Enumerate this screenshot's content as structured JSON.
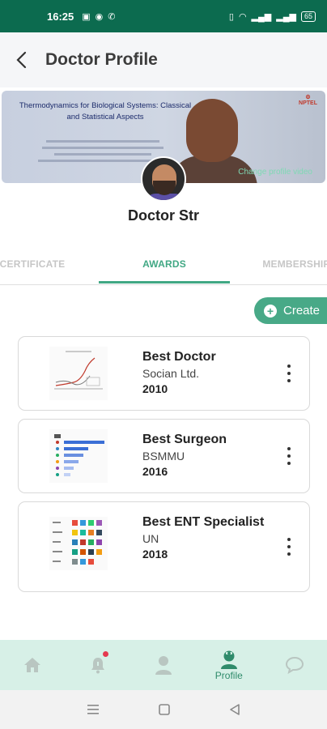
{
  "status_bar": {
    "time": "16:25",
    "battery": "65"
  },
  "header": {
    "title": "Doctor Profile"
  },
  "cover": {
    "slide_title": "Thermodynamics for Biological Systems: Classical and Statistical Aspects",
    "logo_text": "NPTEL",
    "video_link": "Change profile video"
  },
  "profile": {
    "name": "Doctor Str"
  },
  "tabs": [
    {
      "label": "CERTIFICATE",
      "active": false
    },
    {
      "label": "AWARDS",
      "active": true
    },
    {
      "label": "MEMBERSHIP",
      "active": false
    }
  ],
  "actions": {
    "create_label": "Create"
  },
  "awards": [
    {
      "title": "Best Doctor",
      "organization": "Socian Ltd.",
      "year": "2010"
    },
    {
      "title": "Best Surgeon",
      "organization": "BSMMU",
      "year": "2016"
    },
    {
      "title": "Best ENT Specialist",
      "organization": "UN",
      "year": "2018"
    }
  ],
  "bottom_nav": [
    {
      "icon": "home-icon",
      "label": ""
    },
    {
      "icon": "bell-icon",
      "label": ""
    },
    {
      "icon": "person-icon",
      "label": ""
    },
    {
      "icon": "doctor-icon",
      "label": "Profile"
    },
    {
      "icon": "chat-icon",
      "label": ""
    }
  ],
  "colors": {
    "primary": "#0c6b4f",
    "accent": "#41a884",
    "nav_bg": "#d7f0e7"
  }
}
